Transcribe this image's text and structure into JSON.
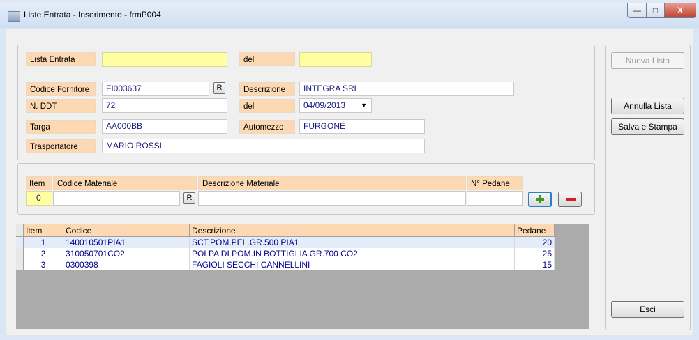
{
  "window": {
    "title": "Liste Entrata - Inserimento - frmP004",
    "controls": {
      "minimize": "—",
      "maximize": "□",
      "close": "X"
    }
  },
  "header": {
    "lista_entrata": {
      "label": "Lista Entrata",
      "value": ""
    },
    "del_lista": {
      "label": "del",
      "value": ""
    },
    "codice_fornitore": {
      "label": "Codice Fornitore",
      "value": "FI003637",
      "lookup": "R"
    },
    "descrizione": {
      "label": "Descrizione",
      "value": "INTEGRA SRL"
    },
    "n_ddt": {
      "label": "N. DDT",
      "value": "72"
    },
    "del_ddt": {
      "label": "del",
      "value": "04/09/2013"
    },
    "targa": {
      "label": "Targa",
      "value": "AA000BB"
    },
    "automezzo": {
      "label": "Automezzo",
      "value": "FURGONE"
    },
    "trasportatore": {
      "label": "Trasportatore",
      "value": "MARIO ROSSI"
    }
  },
  "entry": {
    "headers": {
      "item": "Item",
      "codice": "Codice Materiale",
      "descrizione": "Descrizione Materiale",
      "pedane": "N° Pedane"
    },
    "item_value": "0",
    "codice_value": "",
    "descrizione_value": "",
    "pedane_value": "",
    "lookup": "R",
    "add_icon": "plus-icon",
    "remove_icon": "minus-icon"
  },
  "grid": {
    "columns": [
      "Item",
      "Codice",
      "Descrizione",
      "Pedane"
    ],
    "rows": [
      {
        "item": "1",
        "codice": "140010501PIA1",
        "descrizione": "SCT.POM.PEL.GR.500 PIA1",
        "pedane": "20"
      },
      {
        "item": "2",
        "codice": "310050701CO2",
        "descrizione": "POLPA DI POM.IN BOTTIGLIA GR.700 CO2",
        "pedane": "25"
      },
      {
        "item": "3",
        "codice": "0300398",
        "descrizione": "FAGIOLI SECCHI CANNELLINI",
        "pedane": "15"
      }
    ]
  },
  "actions": {
    "nuova_lista": "Nuova Lista",
    "annulla_lista": "Annulla Lista",
    "salva_stampa": "Salva e Stampa",
    "esci": "Esci"
  }
}
